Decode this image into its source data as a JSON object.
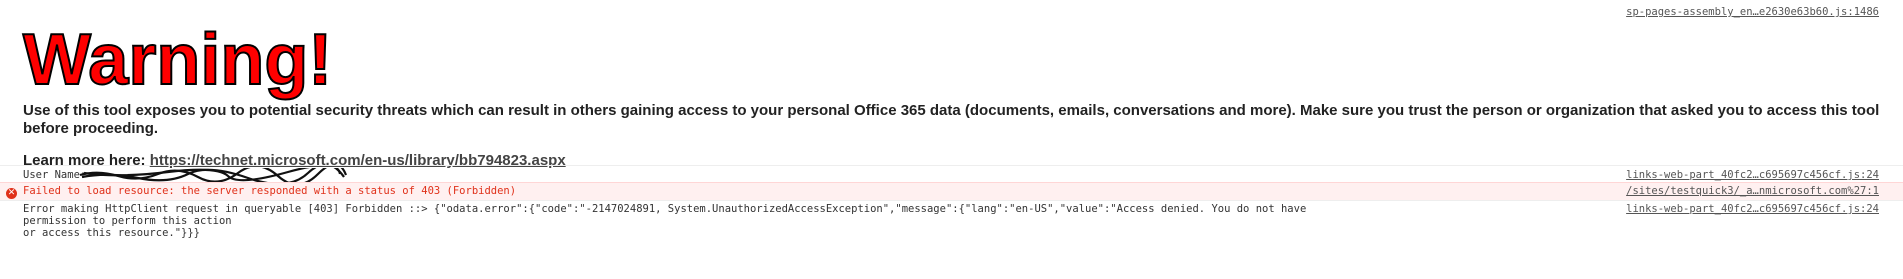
{
  "top_source": "sp-pages-assembly_en…e2630e63b60.js:1486",
  "warning": {
    "title": "Warning!",
    "text": "Use of this tool exposes you to potential security threats which can result in others gaining access to your personal Office 365 data (documents, emails, conversations and more). Make sure you trust the person or organization that asked you to access this tool before proceeding.",
    "learn_prefix": "Learn more here: ",
    "learn_link": "https://technet.microsoft.com/en-us/library/bb794823.aspx"
  },
  "console": {
    "rows": [
      {
        "text": "User Name: ",
        "source": "links-web-part_40fc2…c695697c456cf.js:24"
      },
      {
        "text": "Failed to load resource: the server responded with a status of 403 (Forbidden)",
        "source": "/sites/testquick3/_a…nmicrosoft.com%27:1"
      },
      {
        "text": "Error making HttpClient request in queryable [403] Forbidden ::> {\"odata.error\":{\"code\":\"-2147024891, System.UnauthorizedAccessException\",\"message\":{\"lang\":\"en-US\",\"value\":\"Access denied. You do not have permission to perform this action\nor access this resource.\"}}}",
        "source": "links-web-part_40fc2…c695697c456cf.js:24"
      }
    ]
  },
  "colors": {
    "warning_red": "#ff0000",
    "error_text": "#e0311a",
    "error_bg": "#fff0f0"
  },
  "icons": [
    "error-circle-icon"
  ]
}
